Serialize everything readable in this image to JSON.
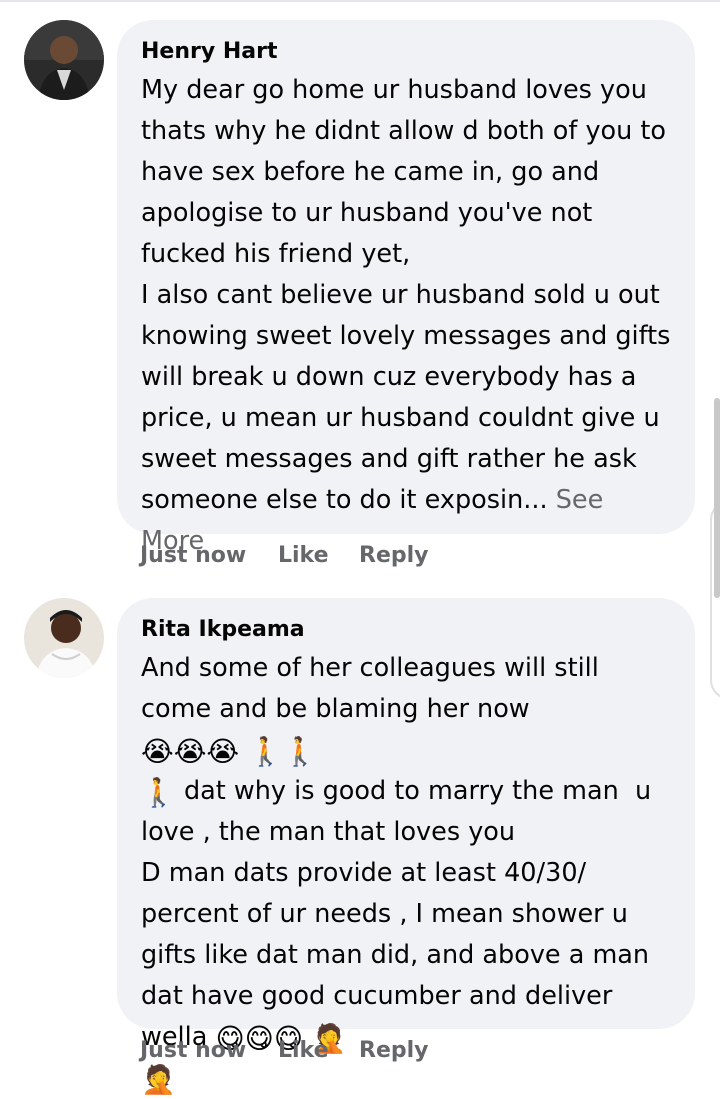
{
  "comments": [
    {
      "author": "Henry Hart",
      "body": "My dear go home ur husband loves you thats why he didnt allow d both of you to have sex before he came in, go and apologise to ur husband you've not fucked his friend yet,\nI also cant believe ur husband sold u out knowing sweet lovely messages and gifts will break u down cuz everybody has a price, u mean ur husband couldnt give u sweet messages and gift rather he ask someone else to do it exposin...",
      "see_more": "See More",
      "time": "Just now",
      "like": "Like",
      "reply": "Reply"
    },
    {
      "author": "Rita Ikpeama",
      "body_part1": "And some of her colleagues will still come and be blaming her now ",
      "emoji1": "😭😭😭 🚶🚶",
      "emoji2": "🚶",
      "body_part2": " dat why is good to marry the man  u love , the man that loves you\nD man dats provide at least 40/30/ percent of ur needs , I mean shower u gifts like dat man did, and above a man dat have good cucumber and deliver wella ",
      "emoji3": "😋😋😋 🤦",
      "emoji4": "🤦",
      "time": "Just now",
      "like": "Like",
      "reply": "Reply"
    }
  ],
  "colors": {
    "bubble": "#f0f2f5",
    "text": "#050505",
    "secondary": "#65676b"
  }
}
